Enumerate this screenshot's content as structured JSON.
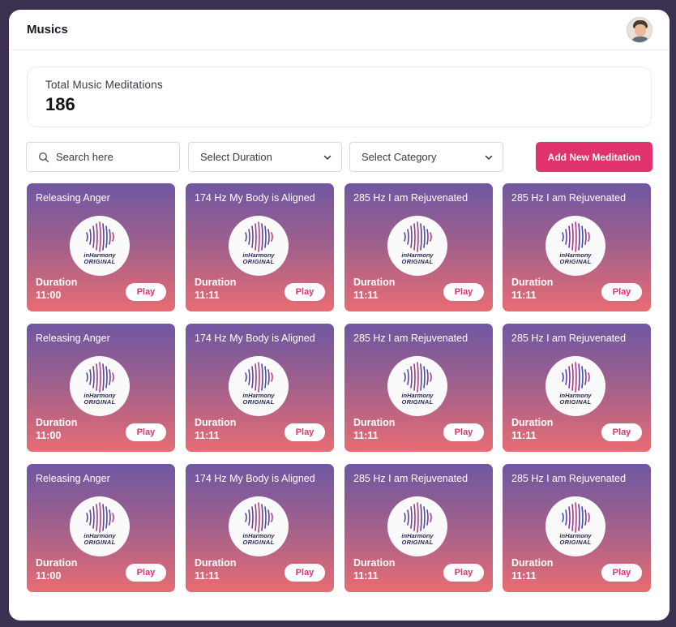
{
  "header": {
    "title": "Musics"
  },
  "stats": {
    "label": "Total Music Meditations",
    "value": "186"
  },
  "filters": {
    "search_placeholder": "Search here",
    "duration": "Select Duration",
    "category": "Select Category",
    "add_button": "Add New Meditation"
  },
  "logo": {
    "line1": "inHarmony",
    "line2": "ORIGINAL"
  },
  "cards": [
    {
      "title": "Releasing Anger",
      "duration_label": "Duration",
      "duration": "11:00",
      "play": "Play"
    },
    {
      "title": "174 Hz My Body is Aligned",
      "duration_label": "Duration",
      "duration": "11:11",
      "play": "Play"
    },
    {
      "title": "285 Hz I am Rejuvenated",
      "duration_label": "Duration",
      "duration": "11:11",
      "play": "Play"
    },
    {
      "title": "285 Hz I am Rejuvenated",
      "duration_label": "Duration",
      "duration": "11:11",
      "play": "Play"
    },
    {
      "title": "Releasing Anger",
      "duration_label": "Duration",
      "duration": "11:00",
      "play": "Play"
    },
    {
      "title": "174 Hz My Body is Aligned",
      "duration_label": "Duration",
      "duration": "11:11",
      "play": "Play"
    },
    {
      "title": "285 Hz I am Rejuvenated",
      "duration_label": "Duration",
      "duration": "11:11",
      "play": "Play"
    },
    {
      "title": "285 Hz I am Rejuvenated",
      "duration_label": "Duration",
      "duration": "11:11",
      "play": "Play"
    },
    {
      "title": "Releasing Anger",
      "duration_label": "Duration",
      "duration": "11:00",
      "play": "Play"
    },
    {
      "title": "174 Hz My Body is Aligned",
      "duration_label": "Duration",
      "duration": "11:11",
      "play": "Play"
    },
    {
      "title": "285 Hz I am Rejuvenated",
      "duration_label": "Duration",
      "duration": "11:11",
      "play": "Play"
    },
    {
      "title": "285 Hz I am Rejuvenated",
      "duration_label": "Duration",
      "duration": "11:11",
      "play": "Play"
    }
  ],
  "colors": {
    "accent": "#e0336d",
    "card_top": "#6f57a1",
    "card_bottom": "#e86c73",
    "backdrop": "#3b3050"
  },
  "icons": {
    "search": "search-icon",
    "dropdown": "chevron-down-icon",
    "avatar": "user-avatar",
    "logo": "inharmony-logo-icon"
  }
}
